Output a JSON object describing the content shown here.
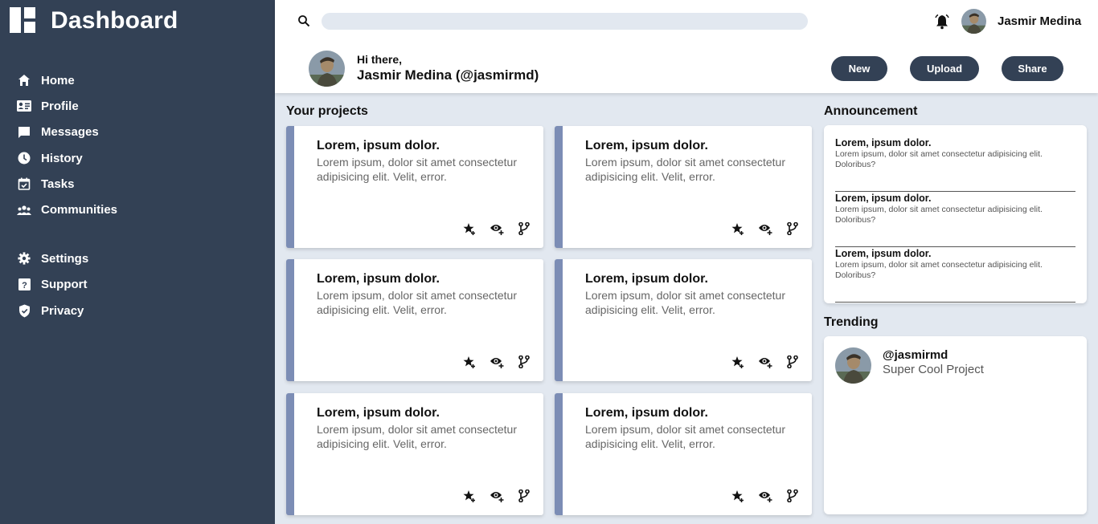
{
  "brand": {
    "title": "Dashboard"
  },
  "nav": {
    "primary": [
      {
        "label": "Home",
        "icon": "home-icon"
      },
      {
        "label": "Profile",
        "icon": "profile-card-icon"
      },
      {
        "label": "Messages",
        "icon": "message-icon"
      },
      {
        "label": "History",
        "icon": "clock-icon"
      },
      {
        "label": "Tasks",
        "icon": "calendar-check-icon"
      },
      {
        "label": "Communities",
        "icon": "people-icon"
      }
    ],
    "secondary": [
      {
        "label": "Settings",
        "icon": "gear-icon"
      },
      {
        "label": "Support",
        "icon": "help-icon"
      },
      {
        "label": "Privacy",
        "icon": "shield-icon"
      }
    ]
  },
  "topbar": {
    "search_placeholder": "",
    "username": "Jasmir Medina",
    "greeting": "Hi there,",
    "full_name": "Jasmir Medina (@jasmirmd)",
    "buttons": {
      "new": "New",
      "upload": "Upload",
      "share": "Share"
    }
  },
  "projects": {
    "title": "Your projects",
    "cards": [
      {
        "title": "Lorem, ipsum dolor.",
        "body": "Lorem ipsum, dolor sit amet consectetur adipisicing elit. Velit, error."
      },
      {
        "title": "Lorem, ipsum dolor.",
        "body": "Lorem ipsum, dolor sit amet consectetur adipisicing elit. Velit, error."
      },
      {
        "title": "Lorem, ipsum dolor.",
        "body": "Lorem ipsum, dolor sit amet consectetur adipisicing elit. Velit, error."
      },
      {
        "title": "Lorem, ipsum dolor.",
        "body": "Lorem ipsum, dolor sit amet consectetur adipisicing elit. Velit, error."
      },
      {
        "title": "Lorem, ipsum dolor.",
        "body": "Lorem ipsum, dolor sit amet consectetur adipisicing elit. Velit, error."
      },
      {
        "title": "Lorem, ipsum dolor.",
        "body": "Lorem ipsum, dolor sit amet consectetur adipisicing elit. Velit, error."
      }
    ]
  },
  "announcement": {
    "title": "Announcement",
    "items": [
      {
        "title": "Lorem, ipsum dolor.",
        "body": "Lorem ipsum, dolor sit amet consectetur adipisicing elit. Doloribus?"
      },
      {
        "title": "Lorem, ipsum dolor.",
        "body": "Lorem ipsum, dolor sit amet consectetur adipisicing elit. Doloribus?"
      },
      {
        "title": "Lorem, ipsum dolor.",
        "body": "Lorem ipsum, dolor sit amet consectetur adipisicing elit. Doloribus?"
      }
    ]
  },
  "trending": {
    "title": "Trending",
    "handle": "@jasmirmd",
    "project": "Super Cool Project"
  },
  "colors": {
    "sidebar": "#334155",
    "background": "#e2e8f0",
    "accent": "#7c8db5"
  }
}
